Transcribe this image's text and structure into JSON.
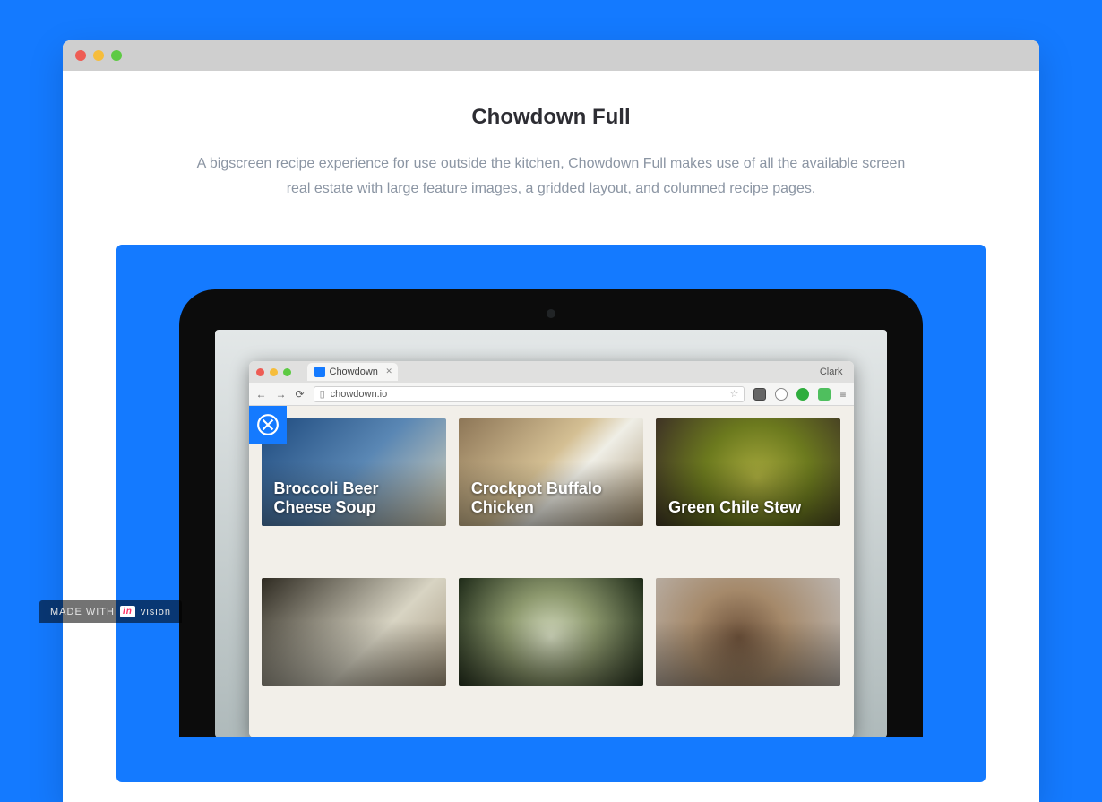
{
  "header": {
    "title": "Chowdown Full",
    "description": "A bigscreen recipe experience for use outside the kitchen, Chowdown Full makes use of all the available screen real estate with large feature images, a gridded layout, and columned recipe pages."
  },
  "browser": {
    "tab_title": "Chowdown",
    "user": "Clark",
    "url": "chowdown.io"
  },
  "recipes": [
    {
      "title": "Broccoli Beer Cheese Soup"
    },
    {
      "title": "Crockpot Buffalo Chicken"
    },
    {
      "title": "Green Chile Stew"
    },
    {
      "title": ""
    },
    {
      "title": ""
    },
    {
      "title": ""
    }
  ],
  "badge": {
    "prefix": "MADE WITH",
    "brand_in": "in",
    "brand_suffix": "vision"
  }
}
